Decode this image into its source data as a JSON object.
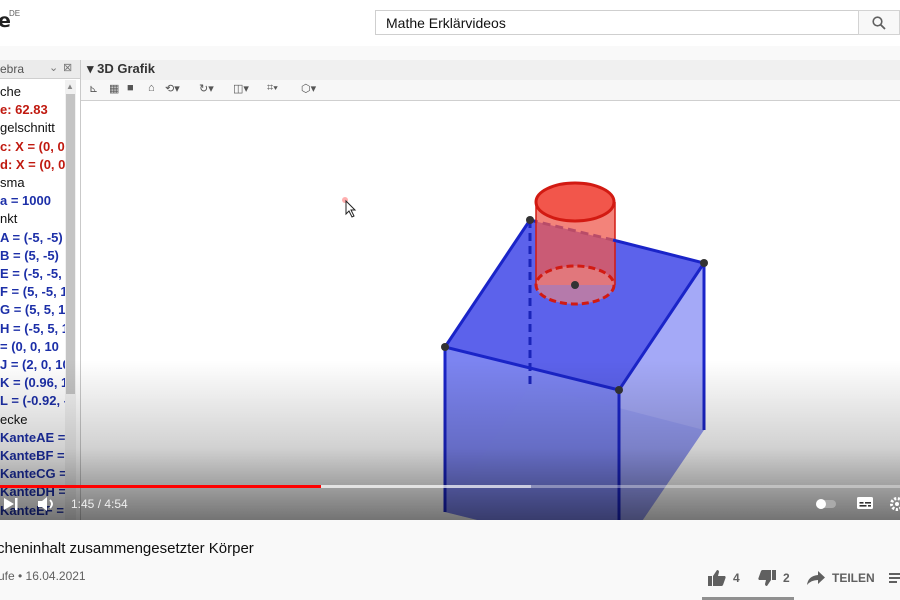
{
  "header": {
    "logo_fragment": "e",
    "logo_region": "DE",
    "search_value": "Mathe Erklärvideos"
  },
  "algebra_view": {
    "title": "ebra",
    "lines": [
      {
        "text": "che",
        "kind": "cat"
      },
      {
        "text": "e: 62.83",
        "kind": "red"
      },
      {
        "text": "gelschnitt",
        "kind": "cat"
      },
      {
        "text": "c: X = (0, 0",
        "kind": "red"
      },
      {
        "text": "d: X = (0, 0",
        "kind": "red"
      },
      {
        "text": "sma",
        "kind": "cat"
      },
      {
        "text": "a = 1000",
        "kind": "blue"
      },
      {
        "text": "nkt",
        "kind": "cat"
      },
      {
        "text": "A = (-5, -5)",
        "kind": "blue"
      },
      {
        "text": "B = (5, -5)",
        "kind": "blue"
      },
      {
        "text": "E = (-5, -5,",
        "kind": "blue"
      },
      {
        "text": "F = (5, -5, 1",
        "kind": "blue"
      },
      {
        "text": "G = (5, 5, 1",
        "kind": "blue"
      },
      {
        "text": "H = (-5, 5, 1",
        "kind": "blue"
      },
      {
        "text": "= (0, 0, 10",
        "kind": "blue"
      },
      {
        "text": "J = (2, 0, 10",
        "kind": "blue"
      },
      {
        "text": "K = (0.96, 1",
        "kind": "blue"
      },
      {
        "text": "L = (-0.92, -",
        "kind": "blue"
      },
      {
        "text": "ecke",
        "kind": "cat"
      },
      {
        "text": "KanteAE =",
        "kind": "blue"
      },
      {
        "text": "KanteBF =",
        "kind": "blue"
      },
      {
        "text": "KanteCG =",
        "kind": "blue"
      },
      {
        "text": "KanteDH =",
        "kind": "blue"
      },
      {
        "text": "KanteEF =",
        "kind": "blue"
      }
    ]
  },
  "graphics_view": {
    "title": "3D Grafik"
  },
  "player": {
    "current_time": "1:45",
    "duration": "4:54",
    "time_text": "1:45 / 4:54",
    "progress_fraction": 0.357,
    "buffer_fraction": 0.59
  },
  "video": {
    "title": "cheninhalt zusammengesetzter Körper",
    "meta": "ufe • 16.04.2021",
    "likes": "4",
    "dislikes": "2",
    "share_label": "TEILEN"
  },
  "colors": {
    "accent": "#ff0000",
    "cube_blue": "#1f2fd0",
    "cylinder_red": "#e8251a"
  }
}
